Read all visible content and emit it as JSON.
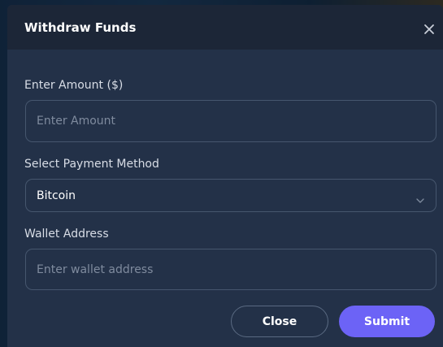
{
  "modal": {
    "title": "Withdraw Funds",
    "close_icon": "close-icon"
  },
  "form": {
    "amount": {
      "label": "Enter Amount ($)",
      "placeholder": "Enter Amount",
      "value": ""
    },
    "payment_method": {
      "label": "Select Payment Method",
      "selected": "Bitcoin",
      "icon": "chevron-down-icon"
    },
    "wallet": {
      "label": "Wallet Address",
      "placeholder": "Enter wallet address",
      "value": ""
    }
  },
  "actions": {
    "close_label": "Close",
    "submit_label": "Submit"
  },
  "colors": {
    "modal_bg": "#233148",
    "header_bg": "#1c2637",
    "accent": "#6c63f6",
    "field_border": "#46566e"
  }
}
